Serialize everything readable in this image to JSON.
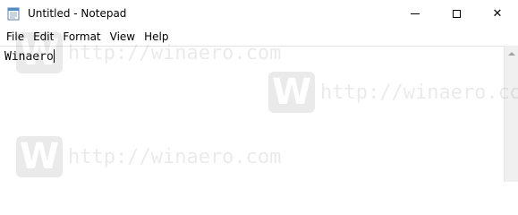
{
  "window": {
    "title": "Untitled - Notepad",
    "app_icon": "notepad-icon"
  },
  "caption_buttons": {
    "minimize_icon": "minimize-icon",
    "maximize_icon": "maximize-icon",
    "close_icon": "close-icon",
    "close_glyph": "✕"
  },
  "menu": {
    "items": [
      "File",
      "Edit",
      "Format",
      "View",
      "Help"
    ]
  },
  "editor": {
    "content": "Winaero"
  },
  "watermark": {
    "logo_letter": "W",
    "url": "http://winaero.com"
  }
}
